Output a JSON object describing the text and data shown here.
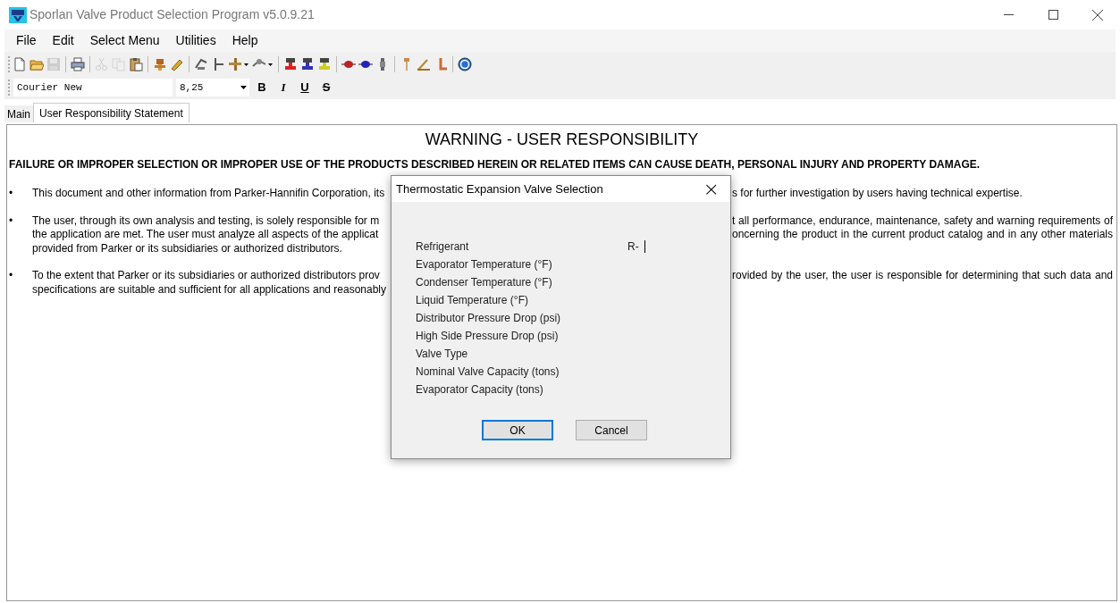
{
  "window": {
    "title": "Sporlan Valve Product Selection Program v5.0.9.21"
  },
  "menu": [
    "File",
    "Edit",
    "Select Menu",
    "Utilities",
    "Help"
  ],
  "toolbar": [
    {
      "kind": "new",
      "disabled": false
    },
    {
      "kind": "open",
      "disabled": false
    },
    {
      "kind": "save",
      "disabled": true
    },
    {
      "kind": "separator"
    },
    {
      "kind": "print",
      "disabled": false
    },
    {
      "kind": "separator"
    },
    {
      "kind": "cut",
      "disabled": true
    },
    {
      "kind": "copy",
      "disabled": true
    },
    {
      "kind": "paste",
      "disabled": false
    },
    {
      "kind": "separator"
    },
    {
      "kind": "valve",
      "disabled": false
    },
    {
      "kind": "pencil",
      "disabled": false
    },
    {
      "kind": "separator"
    },
    {
      "kind": "bulb",
      "disabled": false
    },
    {
      "kind": "tee",
      "disabled": false
    },
    {
      "kind": "fitting",
      "disabled": false
    },
    {
      "kind": "solenoid",
      "disabled": false
    },
    {
      "kind": "separator"
    },
    {
      "kind": "reddistributor",
      "disabled": false
    },
    {
      "kind": "bluedistributor",
      "disabled": false
    },
    {
      "kind": "yellowdistributor",
      "disabled": false
    },
    {
      "kind": "separator"
    },
    {
      "kind": "redfilter",
      "disabled": false
    },
    {
      "kind": "bluefilter",
      "disabled": false
    },
    {
      "kind": "sightglass",
      "disabled": false
    },
    {
      "kind": "separator"
    },
    {
      "kind": "uprightvalve",
      "disabled": false
    },
    {
      "kind": "anglevalve",
      "disabled": false
    },
    {
      "kind": "elbow",
      "disabled": false
    },
    {
      "kind": "separator"
    },
    {
      "kind": "help",
      "disabled": false
    }
  ],
  "font_toolbar": {
    "font": "Courier New",
    "size": "8,25",
    "styles": [
      {
        "kind": "bold",
        "label": "B"
      },
      {
        "kind": "italic",
        "label": "I"
      },
      {
        "kind": "underline",
        "label": "U"
      },
      {
        "kind": "strike",
        "label": "S"
      }
    ]
  },
  "tabs": [
    {
      "label": "Main",
      "selected": false
    },
    {
      "label": "User Responsibility Statement",
      "selected": true
    }
  ],
  "document": {
    "heading": "WARNING - USER RESPONSIBILITY",
    "warning": "FAILURE OR IMPROPER SELECTION OR IMPROPER USE OF THE PRODUCTS DESCRIBED HEREIN OR RELATED ITEMS CAN CAUSE DEATH, PERSONAL INJURY AND PROPERTY DAMAGE.",
    "bullets": [
      {
        "marker": "•",
        "lines": [
          {
            "left": "This document and other information from Parker-Hannifin Corporation, its",
            "right": "s for further investigation by users having technical expertise."
          }
        ]
      },
      {
        "marker": "•",
        "lines": [
          {
            "left": "The user, through its own analysis and testing, is solely responsible for m",
            "right": "t all performance, endurance, maintenance, safety and warning requirements of"
          },
          {
            "left": "the application are met.  The user must analyze all aspects of the applicat",
            "right": "oncerning the product in the current product catalog and in any other materials"
          },
          {
            "left": "provided from Parker or its subsidiaries or authorized distributors."
          }
        ]
      },
      {
        "marker": "•",
        "lines": [
          {
            "left": "To the extent that Parker or its subsidiaries or authorized distributors prov",
            "right": "rovided by the user, the user is responsible for determining that such data and"
          },
          {
            "left": "specifications are suitable and sufficient for all applications and reasonably"
          }
        ]
      }
    ]
  },
  "dialog": {
    "title": "Thermostatic Expansion Valve Selection",
    "close": "×",
    "fields": [
      {
        "label": "Refrigerant",
        "value": "R-",
        "focused": true
      },
      {
        "label": "Evaporator Temperature (°F)"
      },
      {
        "label": "Condenser Temperature (°F)"
      },
      {
        "label": "Liquid Temperature (°F)"
      },
      {
        "label": "Distributor Pressure Drop (psi)"
      },
      {
        "label": "High Side Pressure Drop (psi)"
      },
      {
        "label": "Valve Type"
      },
      {
        "label": "Nominal Valve Capacity (tons)"
      },
      {
        "label": "Evaporator Capacity (tons)"
      }
    ],
    "buttons": [
      {
        "label": "OK",
        "default": true
      },
      {
        "label": "Cancel",
        "default": false
      }
    ]
  }
}
